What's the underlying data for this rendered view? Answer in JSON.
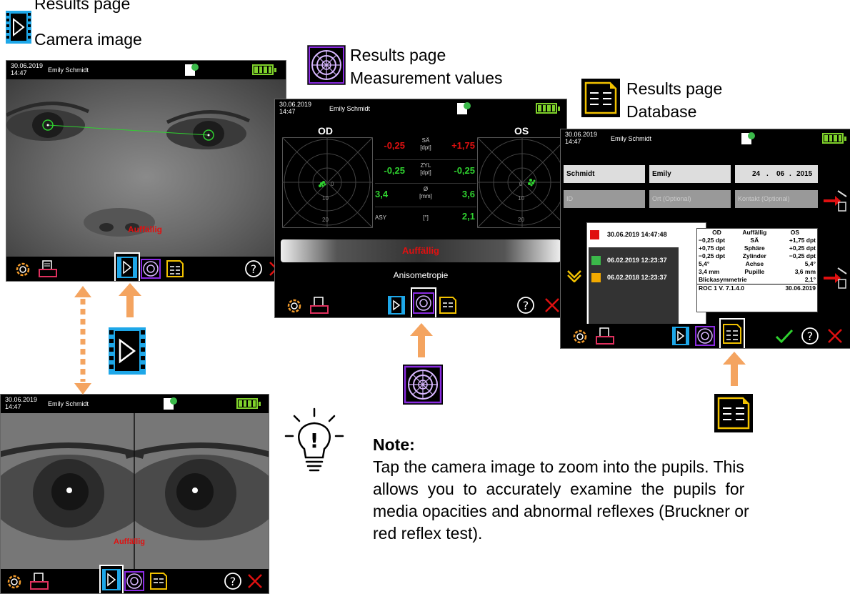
{
  "top_caption": {
    "line1": "Results page",
    "line2": "Camera image"
  },
  "meas_caption": {
    "line1": "Results page",
    "line2": "Measurement values"
  },
  "db_caption": {
    "line1": "Results page",
    "line2": "Database"
  },
  "device": {
    "date": "30.06.2019",
    "time": "14:47",
    "patient": "Emily Schmidt",
    "sd_label": "SD"
  },
  "camera_screen": {
    "result": "Auffällig"
  },
  "zoom_screen": {
    "result": "Auffällig"
  },
  "measurement_screen": {
    "left_eye": "OD",
    "right_eye": "OS",
    "rows": [
      {
        "od": "-0,25",
        "label": "SÄ",
        "unit": "[dpt]",
        "os": "+1,75",
        "color": "red"
      },
      {
        "od": "-0,25",
        "label": "ZYL",
        "unit": "[dpt]",
        "os": "-0,25",
        "color": "green"
      },
      {
        "od": "3,4",
        "label": "Ø",
        "unit": "[mm]",
        "os": "3,6",
        "color": "green"
      },
      {
        "od": "",
        "label": "ASY",
        "unit": "[°]",
        "os": "2,1",
        "color": "green"
      }
    ],
    "ring_labels": [
      "0",
      "10",
      "20"
    ],
    "result_banner": "Auffällig",
    "finding": "Anisometropie"
  },
  "database_screen": {
    "last_name": "Schmidt",
    "first_name": "Emily",
    "dob_day": "24",
    "dob_month": "06",
    "dob_year": "2015",
    "id_placeholder": "ID",
    "place_placeholder": "Ort (Optional)",
    "contact_placeholder": "Kontakt (Optional)",
    "records": [
      {
        "datetime": "30.06.2019 14:47:48",
        "color": "#e01010"
      },
      {
        "datetime": "06.02.2019 12:23:37",
        "color": "#3bb94a"
      },
      {
        "datetime": "06.02.2018 12:23:37",
        "color": "#f2a900"
      }
    ],
    "detail_table": [
      [
        "OD",
        "Auffällig",
        "OS"
      ],
      [
        "−0,25 dpt",
        "SÄ",
        "+1,75  dpt"
      ],
      [
        "+0,75 dpt",
        "Sphäre",
        "+0,25  dpt"
      ],
      [
        "−0,25 dpt",
        "Zylinder",
        "−0,25 dpt"
      ],
      [
        "5,4°",
        "Achse",
        "5,4°"
      ],
      [
        "3,4    mm",
        "Pupille",
        "3,6   mm"
      ],
      [
        "Blickasymmetrie",
        "",
        "2,1°"
      ],
      [
        "ROC 1    V. 7.1.4.0",
        "",
        "30.06.2019"
      ]
    ]
  },
  "note": {
    "title": "Note:",
    "line1": "Tap the camera image to zoom into the pupils. This",
    "line2": "allows  you  to  accurately  examine  the  pupils  for",
    "line3": "media opacities and abnormal reflexes (Bruckner or",
    "line4": "red reflex test)."
  },
  "colors": {
    "accent_orange": "#f4a460",
    "film_blue": "#1ea7e8",
    "target_purple": "#8a2be2",
    "db_yellow": "#f2c200"
  }
}
